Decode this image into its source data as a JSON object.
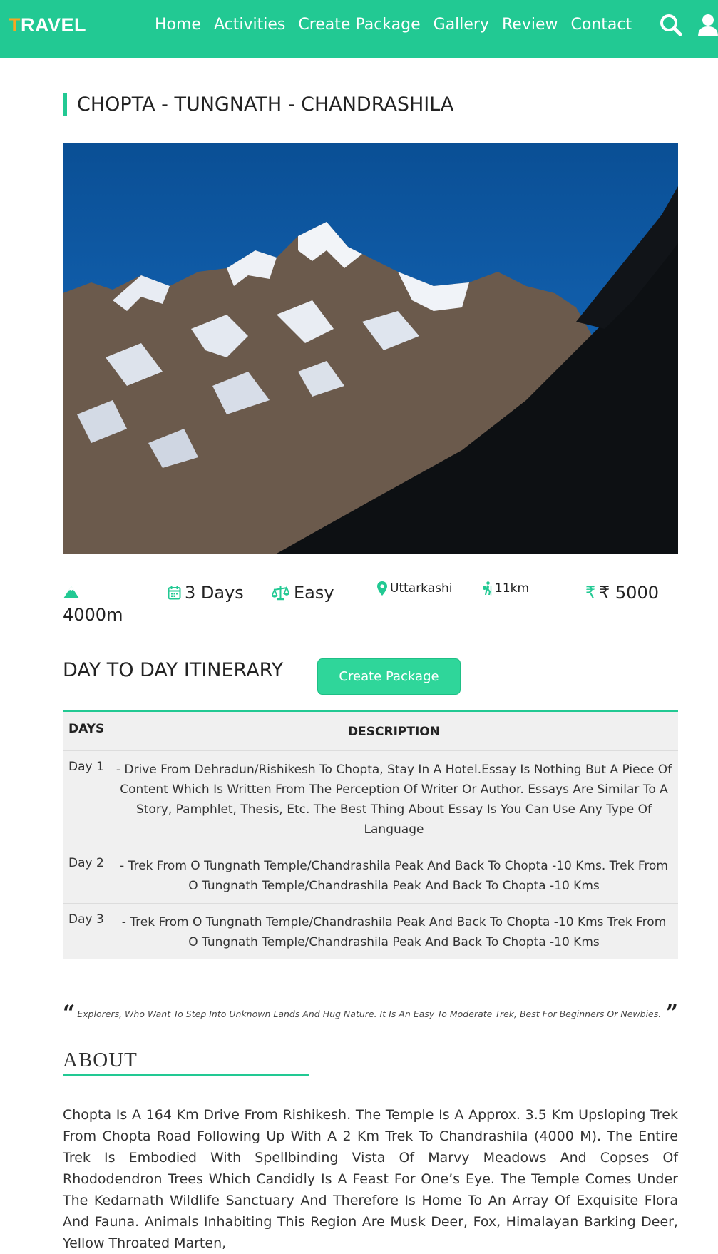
{
  "nav": {
    "logo_first": "T",
    "logo_rest": "RAVEL",
    "items": [
      "Home",
      "Activities",
      "Create Package",
      "Gallery",
      "Review",
      "Contact"
    ]
  },
  "title": "CHOPTA - TUNGNATH - CHANDRASHILA",
  "stats": {
    "altitude": "4000m",
    "duration": "3 Days",
    "difficulty": "Easy",
    "location": "Uttarkashi",
    "distance": "11km",
    "price": "₹ 5000"
  },
  "itinerary": {
    "heading": "DAY TO DAY ITINERARY",
    "button": "Create Package",
    "col_days": "DAYS",
    "col_desc": "DESCRIPTION",
    "rows": [
      {
        "day": "Day 1",
        "desc": "- Drive From Dehradun/Rishikesh To Chopta, Stay In A Hotel.Essay Is Nothing But A Piece Of Content Which Is Written From The Perception Of Writer Or Author. Essays Are Similar To A Story, Pamphlet, Thesis, Etc. The Best Thing About Essay Is You Can Use Any Type Of Language"
      },
      {
        "day": "Day 2",
        "desc": "- Trek From O Tungnath Temple/Chandrashila Peak And Back To Chopta -10 Kms. Trek From O Tungnath Temple/Chandrashila Peak And Back To Chopta -10 Kms"
      },
      {
        "day": "Day 3",
        "desc": "- Trek From O Tungnath Temple/Chandrashila Peak And Back To Chopta -10 Kms Trek From O Tungnath Temple/Chandrashila Peak And Back To Chopta -10 Kms"
      }
    ]
  },
  "quote": "Explorers, Who Want To Step Into Unknown Lands And Hug Nature. It Is An Easy To Moderate Trek, Best For Beginners Or Newbies.",
  "about": {
    "heading": "ABOUT",
    "text": "Chopta Is A 164 Km Drive From Rishikesh. The Temple Is A Approx. 3.5 Km Upsloping Trek From Chopta Road Following Up With A 2 Km Trek To Chandrashila (4000 M). The Entire Trek Is Embodied With Spellbinding Vista Of Marvy Meadows And Copses Of Rhododendron Trees Which Candidly Is A Feast For One’s Eye. The Temple Comes Under The Kedarnath Wildlife Sanctuary And Therefore Is Home To An Array Of Exquisite Flora And Fauna. Animals Inhabiting This Region Are Musk Deer, Fox, Himalayan Barking Deer, Yellow Throated Marten,"
  },
  "colors": {
    "brand": "#22c993",
    "logo_accent": "#f5a623"
  },
  "icons": [
    "search-icon",
    "user-icon",
    "mountain-icon",
    "calendar-icon",
    "balance-scale-icon",
    "map-marker-icon",
    "hiking-icon",
    "rupee-icon"
  ]
}
